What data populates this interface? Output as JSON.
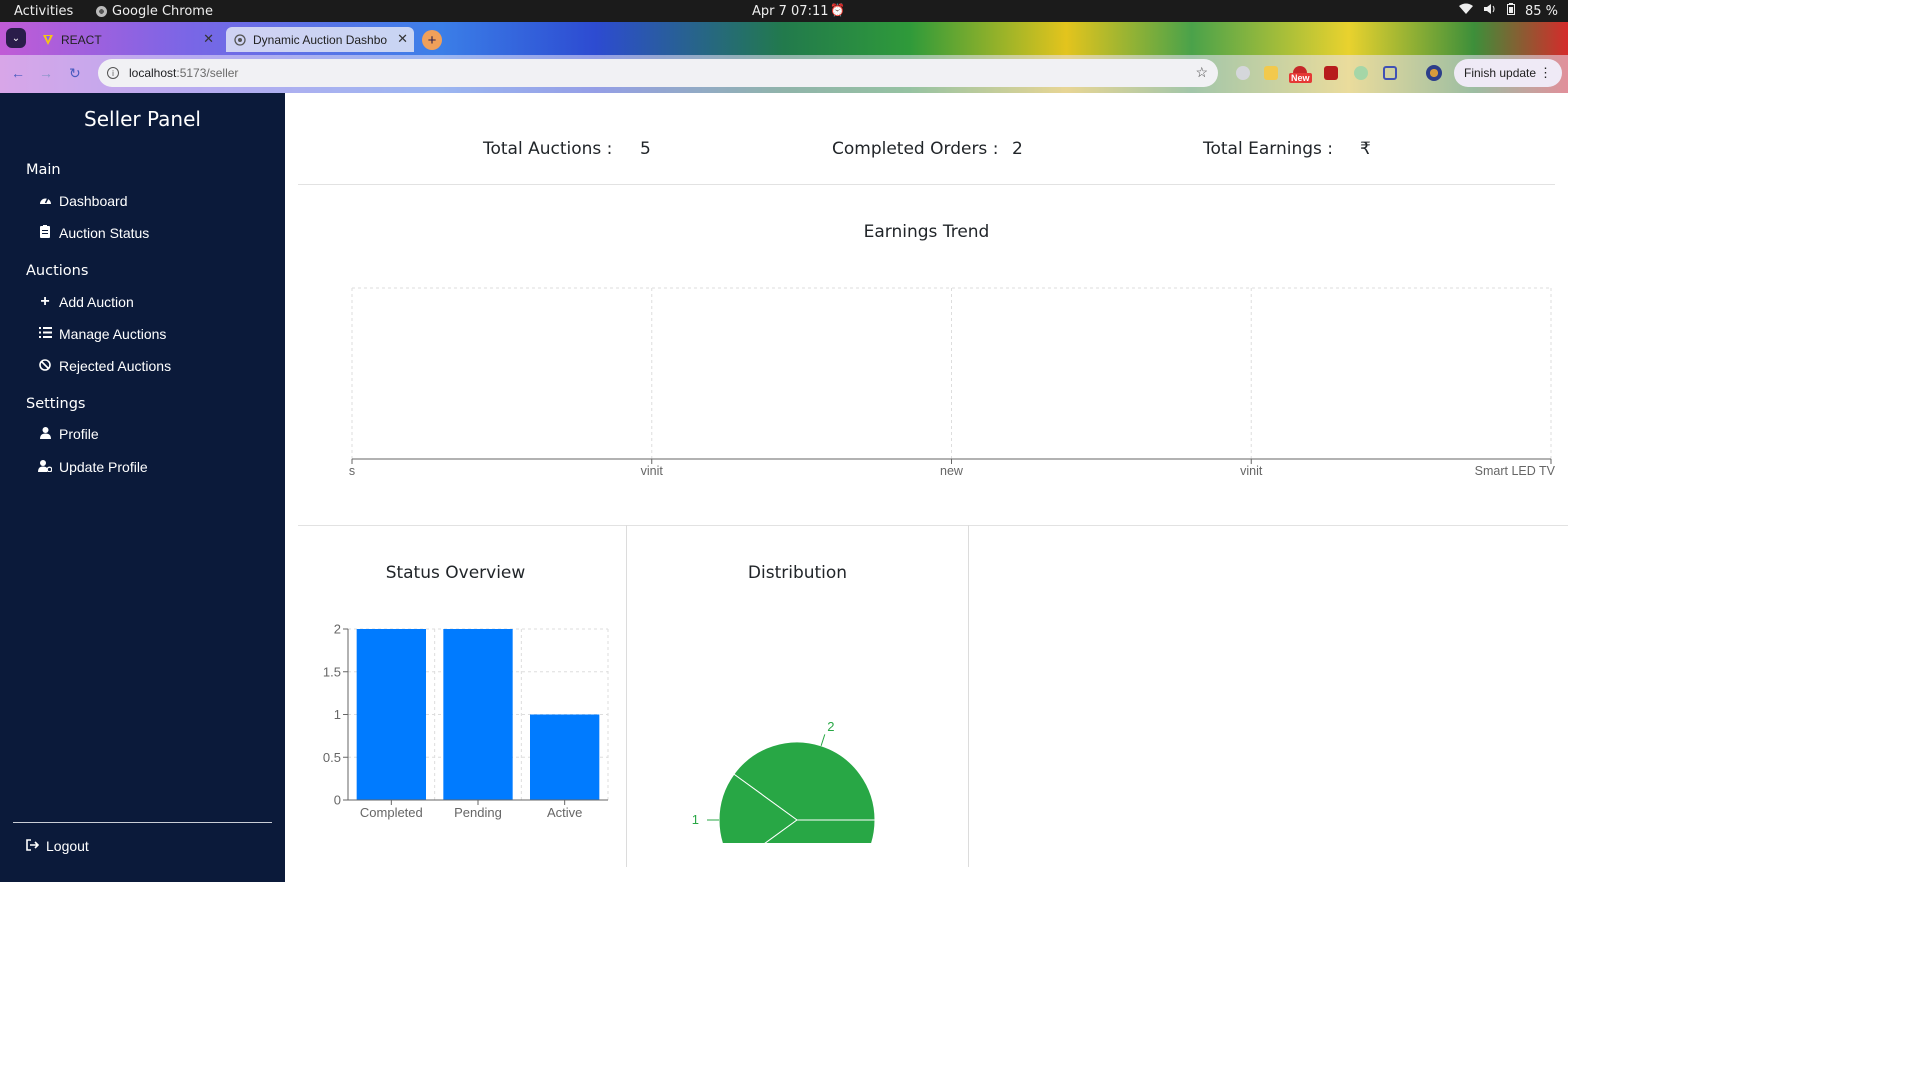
{
  "os": {
    "activities": "Activities",
    "app_name": "Google Chrome",
    "clock": "Apr 7  07:11",
    "battery": "85 %"
  },
  "browser": {
    "tabs": [
      {
        "label": "REACT",
        "icon": "vite-logo-icon"
      },
      {
        "label": "Dynamic Auction Dashbo",
        "icon": "globe-icon"
      }
    ],
    "url_host": "localhost",
    "url_path": ":5173/seller",
    "finish_update": "Finish update",
    "new_badge": "New"
  },
  "sidebar": {
    "brand": "Seller Panel",
    "sections": {
      "main": "Main",
      "auctions": "Auctions",
      "settings": "Settings"
    },
    "items": {
      "dashboard": "Dashboard",
      "auction_status": "Auction Status",
      "add_auction": "Add Auction",
      "manage_auctions": "Manage Auctions",
      "rejected_auctions": "Rejected Auctions",
      "profile": "Profile",
      "update_profile": "Update Profile"
    },
    "logout": "Logout"
  },
  "stats": {
    "total_auctions_label": "Total Auctions :",
    "total_auctions_value": "5",
    "completed_orders_label": "Completed Orders :",
    "completed_orders_value": "2",
    "total_earnings_label": "Total Earnings :",
    "total_earnings_value": "₹"
  },
  "chart_data": [
    {
      "type": "line",
      "title": "Earnings Trend",
      "categories": [
        "s",
        "vinit",
        "new",
        "vinit",
        "Smart LED TV"
      ],
      "series": [],
      "grid": true
    },
    {
      "type": "bar",
      "title": "Status Overview",
      "categories": [
        "Completed",
        "Pending",
        "Active"
      ],
      "values": [
        2,
        2,
        1
      ],
      "ylim": [
        0,
        2
      ],
      "yticks": [
        "0",
        "0.5",
        "1",
        "1.5",
        "2"
      ],
      "color": "#007bff",
      "grid": true
    },
    {
      "type": "pie",
      "title": "Distribution",
      "values": [
        2,
        1,
        2
      ],
      "labels": [
        "2",
        "1",
        "2"
      ],
      "color": "#28a745"
    }
  ]
}
